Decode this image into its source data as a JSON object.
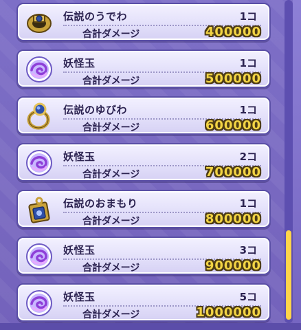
{
  "items": [
    {
      "name": "伝説のうでわ",
      "count": "1コ",
      "label": "合計ダメージ",
      "damage": "400000",
      "icon": "armband-icon"
    },
    {
      "name": "妖怪玉",
      "count": "1コ",
      "label": "合計ダメージ",
      "damage": "500000",
      "icon": "yokai-orb-icon"
    },
    {
      "name": "伝説のゆびわ",
      "count": "1コ",
      "label": "合計ダメージ",
      "damage": "600000",
      "icon": "ring-icon"
    },
    {
      "name": "妖怪玉",
      "count": "2コ",
      "label": "合計ダメージ",
      "damage": "700000",
      "icon": "yokai-orb-icon"
    },
    {
      "name": "伝説のおまもり",
      "count": "1コ",
      "label": "合計ダメージ",
      "damage": "800000",
      "icon": "amulet-icon"
    },
    {
      "name": "妖怪玉",
      "count": "3コ",
      "label": "合計ダメージ",
      "damage": "900000",
      "icon": "yokai-orb-icon"
    },
    {
      "name": "妖怪玉",
      "count": "5コ",
      "label": "合計ダメージ",
      "damage": "1000000",
      "icon": "yokai-orb-icon"
    }
  ],
  "colors": {
    "background": "#7868c0",
    "card": "#e3e0fa",
    "damage_text": "#f2d444",
    "scroll_thumb": "#ffd44a"
  }
}
